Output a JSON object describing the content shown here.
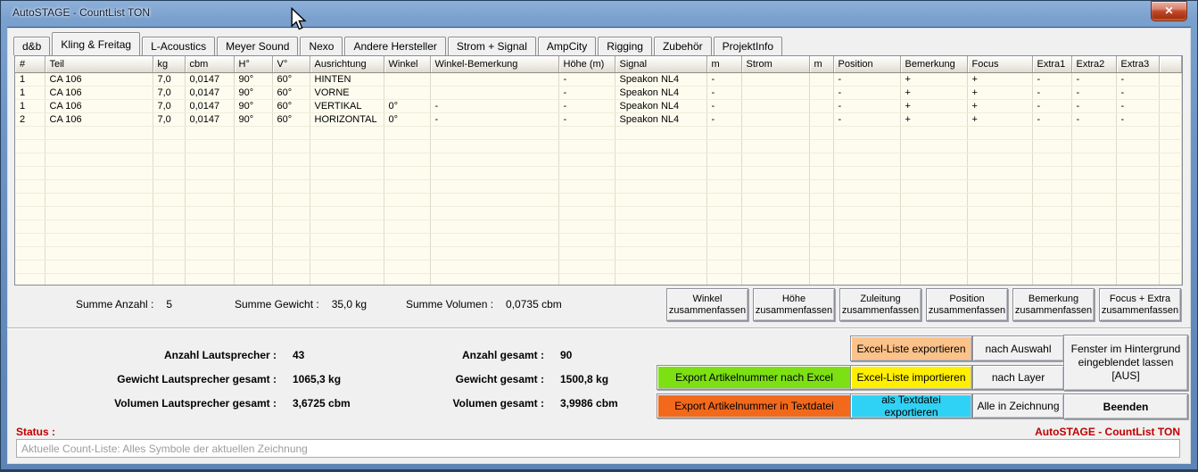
{
  "window": {
    "title": "AutoSTAGE - CountList TON",
    "close_glyph": "✕"
  },
  "tabs": [
    {
      "label": "d&b",
      "active": false
    },
    {
      "label": "Kling & Freitag",
      "active": true
    },
    {
      "label": "L-Acoustics",
      "active": false
    },
    {
      "label": "Meyer Sound",
      "active": false
    },
    {
      "label": "Nexo",
      "active": false
    },
    {
      "label": "Andere Hersteller",
      "active": false
    },
    {
      "label": "Strom + Signal",
      "active": false
    },
    {
      "label": "AmpCity",
      "active": false
    },
    {
      "label": "Rigging",
      "active": false
    },
    {
      "label": "Zubehör",
      "active": false
    },
    {
      "label": "ProjektInfo",
      "active": false
    }
  ],
  "table": {
    "columns": [
      "#",
      "Teil",
      "kg",
      "cbm",
      "H°",
      "V°",
      "Ausrichtung",
      "Winkel",
      "Winkel-Bemerkung",
      "Höhe (m)",
      "Signal",
      "m",
      "Strom",
      "m",
      "Position",
      "Bemerkung",
      "Focus",
      "Extra1",
      "Extra2",
      "Extra3",
      ""
    ],
    "rows": [
      [
        "1",
        "CA 106",
        "7,0",
        "0,0147",
        "90°",
        "60°",
        "HINTEN",
        "",
        "",
        "-",
        "Speakon NL4",
        "-",
        "",
        "",
        "-",
        "+",
        "+",
        "-",
        "-",
        "-",
        ""
      ],
      [
        "1",
        "CA 106",
        "7,0",
        "0,0147",
        "90°",
        "60°",
        "VORNE",
        "",
        "",
        "-",
        "Speakon NL4",
        "-",
        "",
        "",
        "-",
        "+",
        "+",
        "-",
        "-",
        "-",
        ""
      ],
      [
        "1",
        "CA 106",
        "7,0",
        "0,0147",
        "90°",
        "60°",
        "VERTIKAL",
        "0°",
        "-",
        "-",
        "Speakon NL4",
        "-",
        "",
        "",
        "-",
        "+",
        "+",
        "-",
        "-",
        "-",
        ""
      ],
      [
        "2",
        "CA 106",
        "7,0",
        "0,0147",
        "90°",
        "60°",
        "HORIZONTAL",
        "0°",
        "-",
        "-",
        "Speakon NL4",
        "-",
        "",
        "",
        "-",
        "+",
        "+",
        "-",
        "-",
        "-",
        ""
      ]
    ]
  },
  "summary": {
    "anzahl_label": "Summe Anzahl :",
    "anzahl_value": "5",
    "gewicht_label": "Summe Gewicht :",
    "gewicht_value": "35,0 kg",
    "volumen_label": "Summe Volumen :",
    "volumen_value": "0,0735 cbm"
  },
  "summary_buttons": [
    {
      "line1": "Winkel",
      "line2": "zusammenfassen"
    },
    {
      "line1": "Höhe",
      "line2": "zusammenfassen"
    },
    {
      "line1": "Zuleitung",
      "line2": "zusammenfassen"
    },
    {
      "line1": "Position",
      "line2": "zusammenfassen"
    },
    {
      "line1": "Bemerkung",
      "line2": "zusammenfassen"
    },
    {
      "line1": "Focus + Extra",
      "line2": "zusammenfassen"
    }
  ],
  "totals": {
    "left": [
      {
        "label": "Anzahl Lautsprecher :",
        "value": "43"
      },
      {
        "label": "Gewicht Lautsprecher gesamt :",
        "value": "1065,3 kg"
      },
      {
        "label": "Volumen Lautsprecher gesamt :",
        "value": "3,6725 cbm"
      }
    ],
    "right": [
      {
        "label": "Anzahl gesamt :",
        "value": "90"
      },
      {
        "label": "Gewicht gesamt :",
        "value": "1500,8 kg"
      },
      {
        "label": "Volumen gesamt :",
        "value": "3,9986 cbm"
      }
    ]
  },
  "action_buttons": {
    "export_excel": {
      "label": "Export Artikelnummer nach Excel",
      "color": "#7de013"
    },
    "export_text": {
      "label": "Export Artikelnummer in Textdatei",
      "color": "#f2691c"
    },
    "excel_export": {
      "label": "Excel-Liste exportieren",
      "color": "#fbc289"
    },
    "excel_import": {
      "label": "Excel-Liste importieren",
      "color": "#ffef00"
    },
    "text_export": {
      "label": "als Textdatei exportieren",
      "color": "#2fd2f4"
    },
    "nach_auswahl": {
      "label": "nach Auswahl"
    },
    "nach_layer": {
      "label": "nach Layer"
    },
    "alle_in_zeichnung": {
      "label": "Alle in Zeichnung"
    },
    "fenster": {
      "label": "Fenster im Hintergrund eingeblendet lassen [AUS]"
    },
    "beenden": {
      "label": "Beenden"
    }
  },
  "status": {
    "label": "Status :",
    "app_label": "AutoSTAGE - CountList TON",
    "input_value": "Aktuelle Count-Liste: Alles Symbole der aktuellen Zeichnung",
    "accent_color": "#c00000"
  }
}
